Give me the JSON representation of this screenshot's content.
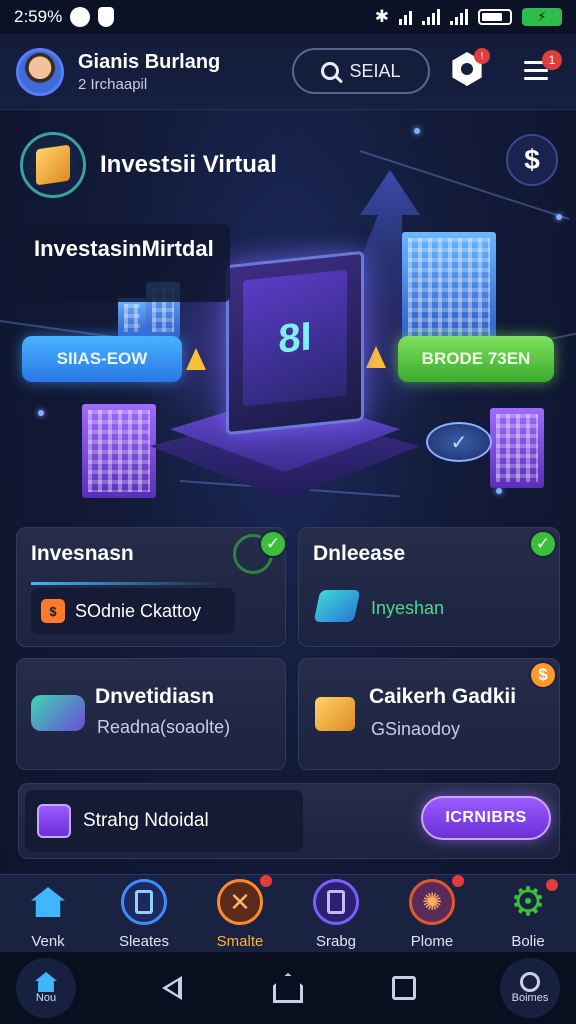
{
  "status_bar": {
    "time": "2:59%"
  },
  "header": {
    "user_name": "Gianis Burlang",
    "user_sub": "2 Irchaapil",
    "search_label": "SEIAL",
    "hex_badge": "!",
    "menu_badge": "1"
  },
  "hero": {
    "title": "Investsii Virtual",
    "label_box": "InvestasinMirtdal",
    "pill_left": "SIIAS-EOW",
    "pill_right": "BRODE 73EN",
    "monolith_text": "8I",
    "dollar_symbol": "$",
    "coin_symbol": "✓"
  },
  "cards": [
    {
      "title": "Invesnasn",
      "sub_label": "SOdnie Ckattoy",
      "sub_icon": "$"
    },
    {
      "title": "Dnleease",
      "text": "Inyeshan"
    },
    {
      "title": "Dnvetidiasn",
      "text": "Readna(soaolte)"
    },
    {
      "title": "Caikerh Gadkii",
      "text": "GSinaodoy"
    }
  ],
  "promo": {
    "label": "Strahg Ndoidal",
    "cta": "ICRNIBRS"
  },
  "tabs": [
    {
      "label": "Venk",
      "icon": "home-icon",
      "color": "#3fb6ff"
    },
    {
      "label": "Sleates",
      "icon": "tablet-icon",
      "color": "#3f8cff"
    },
    {
      "label": "Smalte",
      "icon": "close-circle-icon",
      "color": "#ff8a2a"
    },
    {
      "label": "Srabg",
      "icon": "phone-icon",
      "color": "#7a5cff"
    },
    {
      "label": "Plome",
      "icon": "gear-icon",
      "color": "#e0582a"
    },
    {
      "label": "Bolie",
      "icon": "gear-green-icon",
      "color": "#3bbf3b"
    }
  ],
  "navbar": {
    "home_label": "Nou",
    "profile_label": "Boimes"
  }
}
